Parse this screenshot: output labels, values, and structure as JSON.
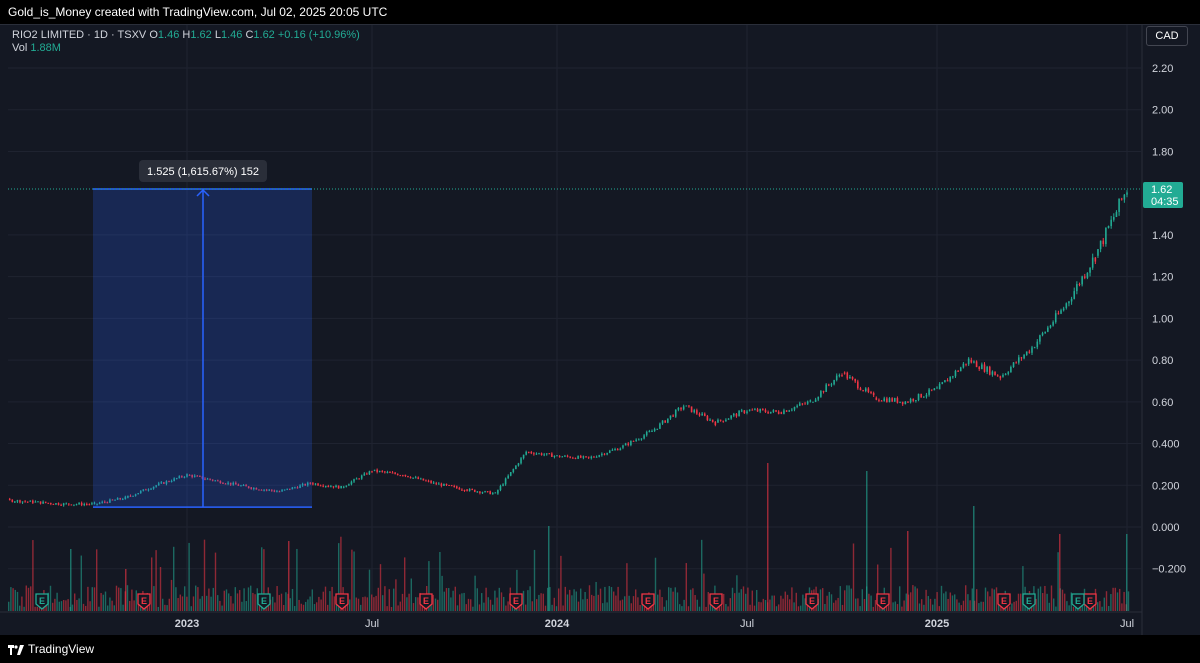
{
  "header": {
    "attribution": "Gold_is_Money created with TradingView.com, Jul 02, 2025 20:05 UTC"
  },
  "footer": {
    "brand": "TradingView"
  },
  "legend": {
    "symbol": "RIO2 LIMITED · 1D · TSXV",
    "o_label": "O",
    "o_value": "1.46",
    "h_label": "H",
    "h_value": "1.62",
    "l_label": "L",
    "l_value": "1.46",
    "c_label": "C",
    "c_value": "1.62",
    "change": "+0.16 (+10.96%)",
    "vol_label": "Vol",
    "vol_value": "1.88M"
  },
  "currency_button": "CAD",
  "price_label": {
    "price": "1.62",
    "countdown": "04:35"
  },
  "measure_label": "1.525 (1,615.67%) 152",
  "colors": {
    "up": "#22ab94",
    "down": "#f23645",
    "accent": "#2962ff",
    "background": "#141823"
  },
  "chart_data": {
    "type": "candlestick",
    "title": "RIO2 LIMITED · 1D · TSXV",
    "currency": "CAD",
    "y_ticks": [
      "2.20",
      "2.00",
      "1.80",
      "1.40",
      "1.20",
      "1.00",
      "0.80",
      "0.60",
      "0.400",
      "0.200",
      "0.000",
      "−0.200"
    ],
    "x_ticks": [
      "2023",
      "Jul",
      "2024",
      "Jul",
      "2025",
      "Jul"
    ],
    "ylim": [
      -0.2,
      2.25
    ],
    "grid": true,
    "price_series": [
      {
        "date": "2022-05",
        "close": 0.17
      },
      {
        "date": "2022-06",
        "close": 0.15
      },
      {
        "date": "2022-07",
        "close": 0.13
      },
      {
        "date": "2022-08",
        "close": 0.12
      },
      {
        "date": "2022-09",
        "close": 0.11
      },
      {
        "date": "2022-10",
        "close": 0.11
      },
      {
        "date": "2022-11",
        "close": 0.14
      },
      {
        "date": "2022-12",
        "close": 0.2
      },
      {
        "date": "2023-01",
        "close": 0.25
      },
      {
        "date": "2023-02",
        "close": 0.22
      },
      {
        "date": "2023-03",
        "close": 0.19
      },
      {
        "date": "2023-04",
        "close": 0.17
      },
      {
        "date": "2023-05",
        "close": 0.21
      },
      {
        "date": "2023-06",
        "close": 0.19
      },
      {
        "date": "2023-07",
        "close": 0.27
      },
      {
        "date": "2023-08",
        "close": 0.25
      },
      {
        "date": "2023-09",
        "close": 0.21
      },
      {
        "date": "2023-10",
        "close": 0.18
      },
      {
        "date": "2023-11",
        "close": 0.16
      },
      {
        "date": "2023-12",
        "close": 0.36
      },
      {
        "date": "2024-01",
        "close": 0.34
      },
      {
        "date": "2024-02",
        "close": 0.33
      },
      {
        "date": "2024-03",
        "close": 0.38
      },
      {
        "date": "2024-04",
        "close": 0.46
      },
      {
        "date": "2024-05",
        "close": 0.58
      },
      {
        "date": "2024-06",
        "close": 0.5
      },
      {
        "date": "2024-07",
        "close": 0.56
      },
      {
        "date": "2024-08",
        "close": 0.55
      },
      {
        "date": "2024-09",
        "close": 0.6
      },
      {
        "date": "2024-10",
        "close": 0.74
      },
      {
        "date": "2024-11",
        "close": 0.62
      },
      {
        "date": "2024-12",
        "close": 0.6
      },
      {
        "date": "2025-01",
        "close": 0.66
      },
      {
        "date": "2025-02",
        "close": 0.8
      },
      {
        "date": "2025-03",
        "close": 0.72
      },
      {
        "date": "2025-04",
        "close": 0.86
      },
      {
        "date": "2025-05",
        "close": 1.05
      },
      {
        "date": "2025-06",
        "close": 1.3
      },
      {
        "date": "2025-07",
        "close": 1.62
      }
    ],
    "measure": {
      "from": 0.095,
      "to": 1.62,
      "change": "1.525 (1,615.67%) 152"
    },
    "earnings_markers": [
      {
        "type": "E",
        "tone": "up"
      },
      {
        "type": "E",
        "tone": "down"
      },
      {
        "type": "E",
        "tone": "up"
      },
      {
        "type": "E",
        "tone": "down"
      },
      {
        "type": "E",
        "tone": "down"
      },
      {
        "type": "E",
        "tone": "down"
      },
      {
        "type": "E",
        "tone": "down"
      },
      {
        "type": "E",
        "tone": "down"
      },
      {
        "type": "E",
        "tone": "down"
      },
      {
        "type": "E",
        "tone": "down"
      },
      {
        "type": "E",
        "tone": "down"
      },
      {
        "type": "E",
        "tone": "down"
      },
      {
        "type": "E",
        "tone": "down"
      },
      {
        "type": "E",
        "tone": "up"
      },
      {
        "type": "E",
        "tone": "up"
      }
    ]
  }
}
